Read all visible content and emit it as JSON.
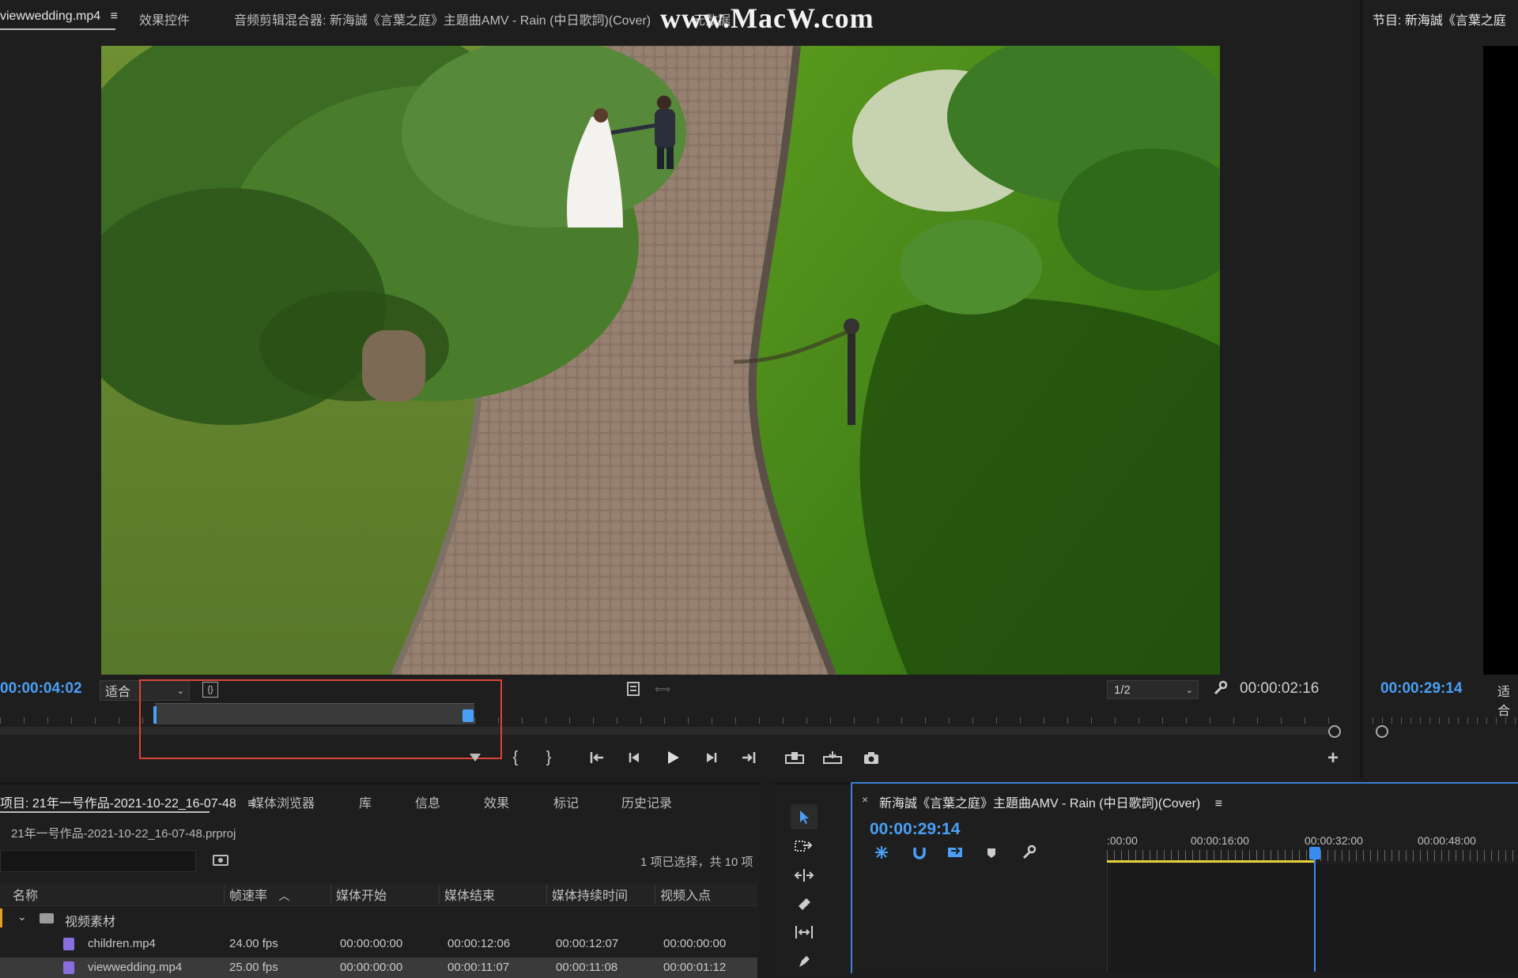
{
  "source_panel": {
    "tabs": [
      "viewwedding.mp4",
      "效果控件",
      "音频剪辑混合器: 新海誠《言葉之庭》主題曲AMV - Rain (中日歌詞)(Cover)",
      "元数据"
    ],
    "menu_icon": "≡",
    "timecode_left": "00:00:04:02",
    "zoom_label": "适合",
    "resolution": "1/2",
    "timecode_right": "00:00:02:16"
  },
  "program_panel": {
    "title": "节目: 新海誠《言葉之庭",
    "timecode": "00:00:29:14",
    "zoom_label": "适合"
  },
  "watermark": "www.MacW.com",
  "project_panel": {
    "tabs": [
      "项目: 21年一号作品-2021-10-22_16-07-48",
      "媒体浏览器",
      "库",
      "信息",
      "效果",
      "标记",
      "历史记录"
    ],
    "file_path": "21年一号作品-2021-10-22_16-07-48.prproj",
    "selection_info": "1 项已选择，共 10 项",
    "columns": [
      "名称",
      "帧速率",
      "媒体开始",
      "媒体结束",
      "媒体持续时间",
      "视频入点"
    ],
    "folder": "视频素材",
    "rows": [
      {
        "name": "children.mp4",
        "fps": "24.00 fps",
        "start": "00:00:00:00",
        "end": "00:00:12:06",
        "duration": "00:00:12:07",
        "in": "00:00:00:00"
      },
      {
        "name": "viewwedding.mp4",
        "fps": "25.00 fps",
        "start": "00:00:00:00",
        "end": "00:00:11:07",
        "duration": "00:00:11:08",
        "in": "00:00:01:12"
      }
    ]
  },
  "timeline_panel": {
    "title": "新海誠《言葉之庭》主題曲AMV - Rain (中日歌詞)(Cover)",
    "timecode": "00:00:29:14",
    "ruler": [
      ":00:00",
      "00:00:16:00",
      "00:00:32:00",
      "00:00:48:00"
    ]
  },
  "colors": {
    "accent": "#4a9ff5",
    "highlight_box": "#e0413b",
    "playhead": "#3b8cf0",
    "work_area": "#e8d23a"
  }
}
